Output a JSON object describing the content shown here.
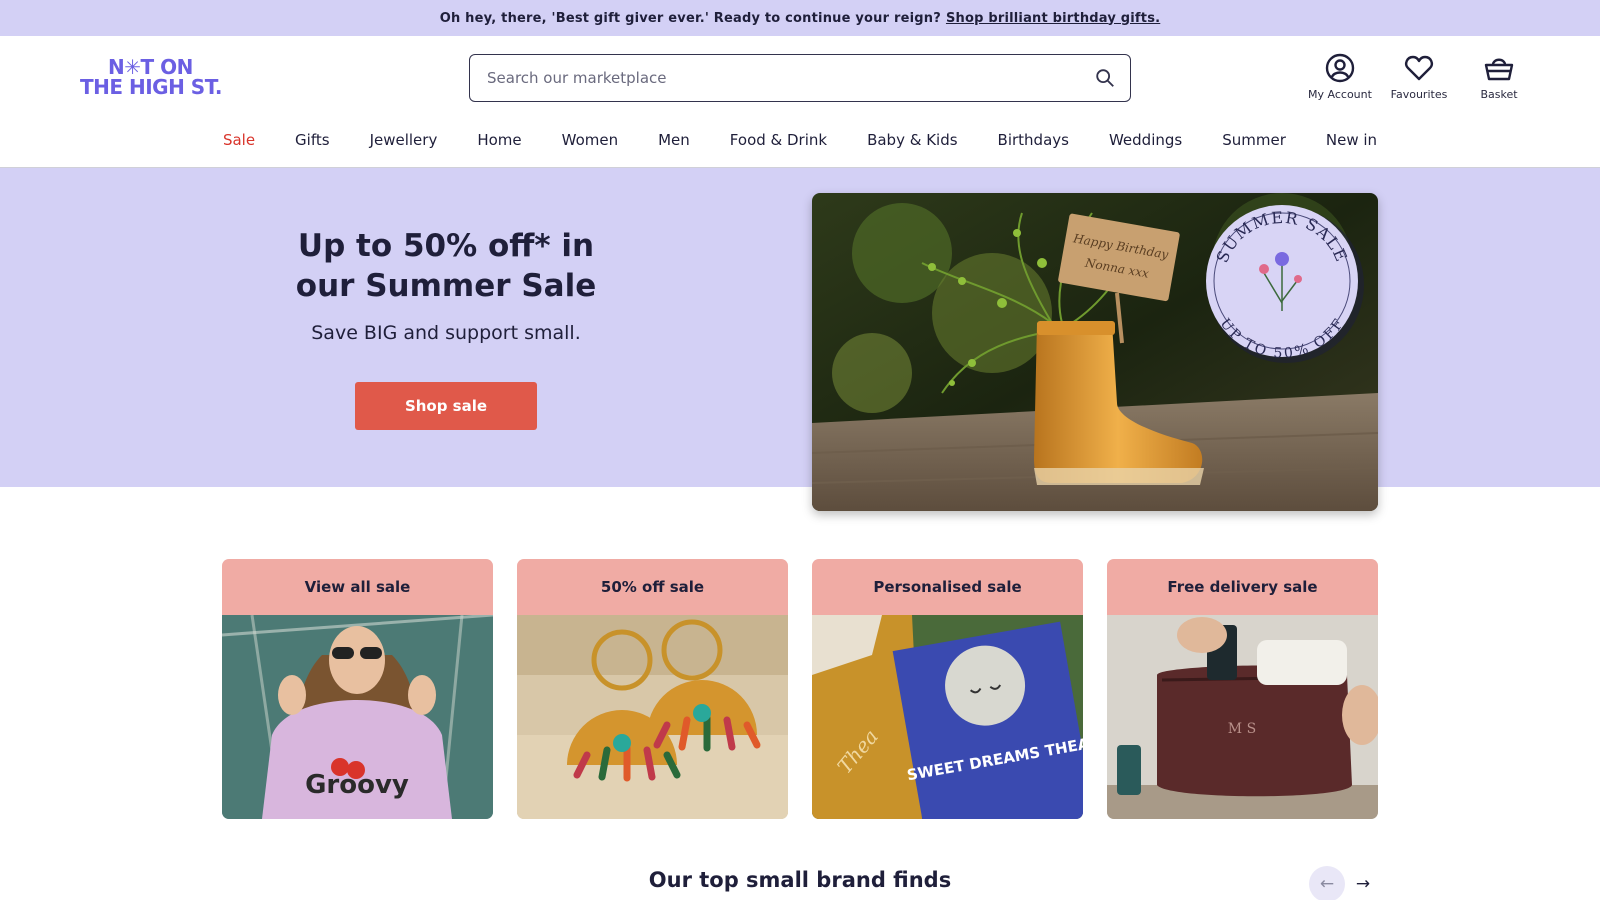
{
  "promo": {
    "text": "Oh hey, there, 'Best gift giver ever.' Ready to continue your reign?",
    "link": "Shop brilliant birthday gifts."
  },
  "logo": {
    "line1": "N✳T ON",
    "line2": "THE HIGH ST."
  },
  "search": {
    "placeholder": "Search our marketplace",
    "icon": "search-icon"
  },
  "header_actions": [
    {
      "label": "My Account",
      "icon": "account-icon"
    },
    {
      "label": "Favourites",
      "icon": "heart-icon"
    },
    {
      "label": "Basket",
      "icon": "basket-icon"
    }
  ],
  "nav": [
    "Sale",
    "Gifts",
    "Jewellery",
    "Home",
    "Women",
    "Men",
    "Food & Drink",
    "Baby & Kids",
    "Birthdays",
    "Weddings",
    "Summer",
    "New in"
  ],
  "hero": {
    "title_line1": "Up to 50% off* in",
    "title_line2": "our Summer Sale",
    "subtitle": "Save BIG and support small.",
    "button": "Shop sale",
    "image_sign_line1": "Happy Birthday",
    "image_sign_line2": "Nonna xxx",
    "badge_top": "SUMMER SALE",
    "badge_bottom": "UP TO 50% OFF"
  },
  "cards": [
    {
      "title": "View all sale",
      "image_text": "Groovy"
    },
    {
      "title": "50% off sale"
    },
    {
      "title": "Personalised sale",
      "image_text_1": "SWEET DREAMS THEA",
      "image_text_2": "Thea"
    },
    {
      "title": "Free delivery sale",
      "image_text": "M S"
    }
  ],
  "section": {
    "title": "Our top small brand finds"
  },
  "colors": {
    "brand_purple": "#6b5fe3",
    "hero_bg": "#d3d0f5",
    "sale_red": "#d9342b",
    "button": "#e0594a",
    "card_header": "#f0aba4"
  }
}
